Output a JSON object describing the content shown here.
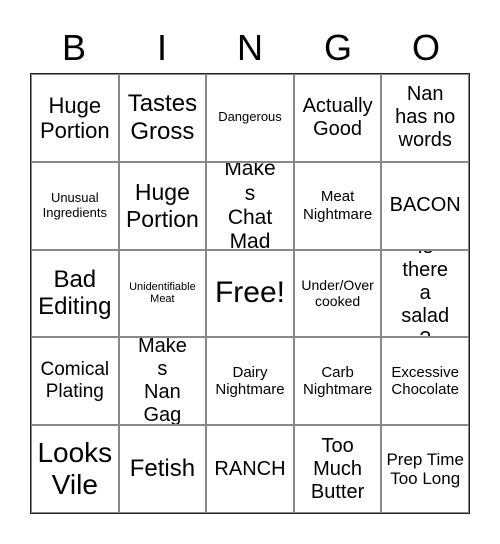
{
  "header": [
    "B",
    "I",
    "N",
    "G",
    "O"
  ],
  "cells": [
    "Huge Portion",
    "Tastes Gross",
    "Dangerous",
    "Actually Good",
    "Nan has no words",
    "Unusual Ingredients",
    "Huge Portion",
    "Makes Chat Mad",
    "Meat Nightmare",
    "BACON",
    "Bad Editing",
    "Unidentifiable Meat",
    "Free!",
    "Under/Over cooked",
    "Is there a salad?",
    "Comical Plating",
    "Makes Nan Gag",
    "Dairy Nightmare",
    "Carb Nightmare",
    "Excessive Chocolate",
    "Looks Vile",
    "Fetish",
    "RANCH",
    "Too Much Butter",
    "Prep Time Too Long"
  ]
}
